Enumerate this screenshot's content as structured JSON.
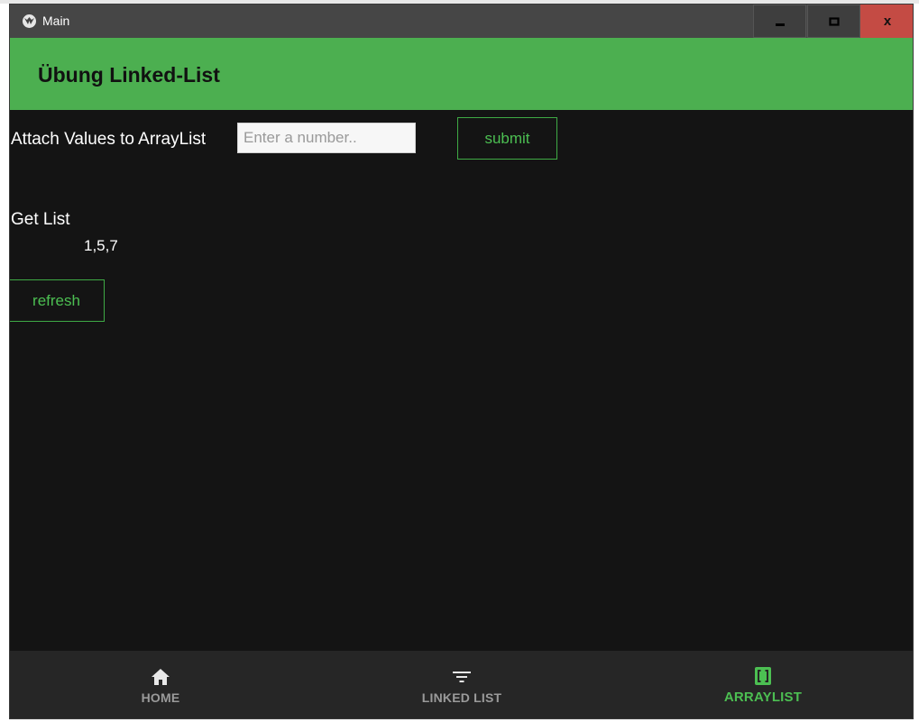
{
  "window": {
    "title": "Main",
    "controls": {
      "close_label": "x"
    }
  },
  "appbar": {
    "title": "Übung Linked-List",
    "color": "#4caf50"
  },
  "form": {
    "attach_label": "Attach Values to ArrayList",
    "input_placeholder": "Enter a number..",
    "input_value": "",
    "submit_label": "submit"
  },
  "list": {
    "get_label": "Get List",
    "value": "1,5,7",
    "refresh_label": "refresh"
  },
  "nav": {
    "items": [
      {
        "label": "HOME",
        "icon": "home-icon",
        "active": false
      },
      {
        "label": "LINKED LIST",
        "icon": "filter-icon",
        "active": false
      },
      {
        "label": "ARRAYLIST",
        "icon": "brackets-icon",
        "active": true
      }
    ],
    "active_color": "#4cbf52",
    "inactive_color": "#9a9a9a"
  }
}
